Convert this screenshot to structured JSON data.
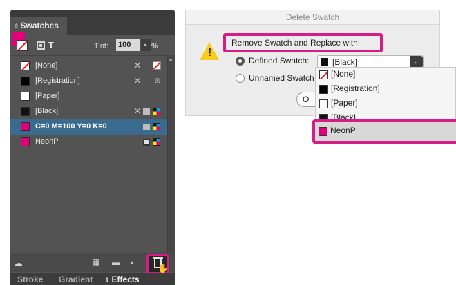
{
  "swatches_panel": {
    "tab_label": "Swatches",
    "text_icon_label": "T",
    "tint_label": "Tint:",
    "tint_value": "100",
    "tint_stepper_glyph": "▸",
    "tint_unit": "%",
    "items": [
      {
        "label": "[None]",
        "chip_color": "#ffffff"
      },
      {
        "label": "[Registration]",
        "chip_color": "#000000"
      },
      {
        "label": "[Paper]",
        "chip_color": "#ffffff"
      },
      {
        "label": "[Black]",
        "chip_color": "#111111"
      },
      {
        "label": "C=0 M=100 Y=0 K=0",
        "chip_color": "#e0007a",
        "selected": true
      },
      {
        "label": "NeonP",
        "chip_color": "#e0007a"
      }
    ],
    "bottom_tabs": [
      "Stroke",
      "Gradient",
      "Effects"
    ],
    "selection_color": "#3a6b8e",
    "highlight_color": "#d81c86"
  },
  "delete_dialog": {
    "title": "Delete Swatch",
    "prompt": "Remove Swatch and Replace with:",
    "option_defined": "Defined Swatch:",
    "option_unnamed": "Unnamed Swatch",
    "selected_swatch": "[Black]",
    "ok_button_partial": "O"
  },
  "dropdown": {
    "items": [
      {
        "label": "[None]",
        "chip_color": "#ffffff"
      },
      {
        "label": "[Registration]",
        "chip_color": "#000000"
      },
      {
        "label": "[Paper]",
        "chip_color": "#ffffff"
      },
      {
        "label": "[Black]",
        "chip_color": "#111111"
      },
      {
        "label": "NeonP",
        "chip_color": "#e0007a",
        "highlighted": true
      }
    ]
  }
}
